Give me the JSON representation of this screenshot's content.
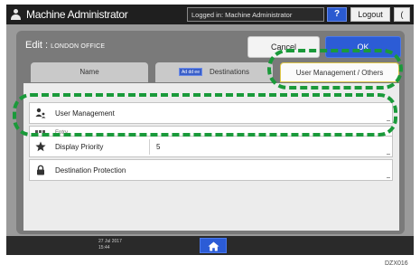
{
  "topbar": {
    "title": "Machine Administrator",
    "login_status": "Logged in: Machine Administrator",
    "help_label": "?",
    "logout_label": "Logout",
    "back_label": "(",
    "user_icon": "user-icon"
  },
  "edit": {
    "prefix": "Edit : ",
    "name": "LONDON OFFICE",
    "cancel_label": "Cancel",
    "ok_label": "OK"
  },
  "tabs": [
    {
      "label": "Name",
      "selected": false
    },
    {
      "label": "Destinations",
      "selected": false,
      "icon_text": "Ad dd ee"
    },
    {
      "label": "User Management / Others",
      "selected": true
    }
  ],
  "rows": [
    {
      "icon": "user-management-icon",
      "label": "User Management",
      "value": ""
    },
    {
      "icon": "entry-icon",
      "label": "Entry",
      "value": ""
    },
    {
      "icon": "star-icon",
      "label": "Display Priority",
      "value": "5"
    },
    {
      "icon": "lock-icon",
      "label": "Destination Protection",
      "value": ""
    }
  ],
  "bottombar": {
    "datetime": "27 Jul 2017\n15:44",
    "home_icon": "home-icon"
  },
  "figure_code": "DZX016",
  "colors": {
    "highlight": "#1a9a3a",
    "accent_blue": "#2c5cd6",
    "header_dark": "#1f1f1f"
  }
}
